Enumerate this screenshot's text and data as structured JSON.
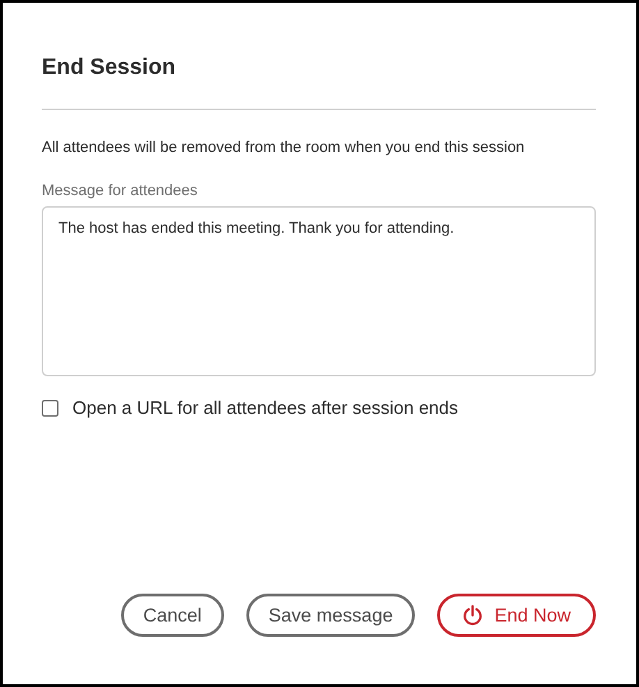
{
  "dialog": {
    "title": "End Session"
  },
  "notice": "All attendees will be removed from the room when you end this session",
  "message": {
    "label": "Message for attendees",
    "value": "The host has ended this meeting. Thank you for attending."
  },
  "open_url": {
    "label": "Open a URL for all attendees after session ends",
    "checked": false
  },
  "buttons": [
    {
      "label": "Cancel",
      "kind": "secondary"
    },
    {
      "label": "Save message",
      "kind": "secondary"
    },
    {
      "label": "End Now",
      "kind": "danger"
    }
  ]
}
